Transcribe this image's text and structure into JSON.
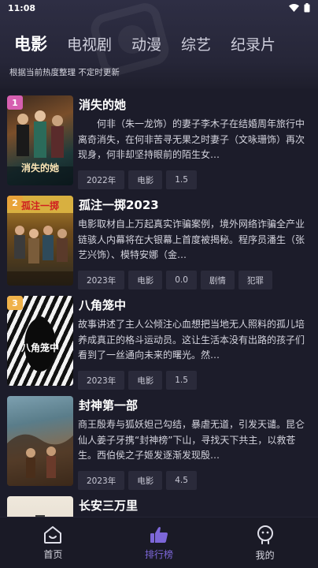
{
  "status": {
    "time": "11:08"
  },
  "tabs": [
    {
      "label": "电影"
    },
    {
      "label": "电视剧"
    },
    {
      "label": "动漫"
    },
    {
      "label": "综艺"
    },
    {
      "label": "纪录片"
    }
  ],
  "subtitle": "根据当前热度整理 不定时更新",
  "items": [
    {
      "rank": "1",
      "title": "消失的她",
      "poster_text": "消失的她",
      "description": "何非（朱一龙饰）的妻子李木子在结婚周年旅行中离奇消失，在何非苦寻无果之时妻子（文咏珊饰）再次现身，何非却坚持眼前的陌生女…",
      "tags": [
        "2022年",
        "电影",
        "1.5"
      ]
    },
    {
      "rank": "2",
      "title": "孤注一掷2023",
      "poster_text": "孤注一掷",
      "description": "电影取材自上万起真实诈骗案例，境外网络诈骗全产业链骇人内幕将在大银幕上首度被揭秘。程序员潘生（张艺兴饰）、模特安娜（金…",
      "tags": [
        "2023年",
        "电影",
        "0.0",
        "剧情",
        "犯罪"
      ]
    },
    {
      "rank": "3",
      "title": "八角笼中",
      "poster_text": "八角笼中",
      "description": "故事讲述了主人公倾注心血想把当地无人照料的孤儿培养成真正的格斗运动员。这让生活本没有出路的孩子们看到了一丝通向未来的曙光。然…",
      "tags": [
        "2023年",
        "电影",
        "1.5"
      ]
    },
    {
      "rank": "",
      "title": "封神第一部",
      "poster_text": "",
      "description": "商王殷寿与狐妖妲己勾结，暴虐无道，引发天谴。昆仑仙人姜子牙携“封神榜”下山，寻找天下共主，以救苍生。西伯侯之子姬发逐渐发现殷…",
      "tags": [
        "2023年",
        "电影",
        "4.5"
      ]
    },
    {
      "rank": "",
      "title": "长安三万里",
      "poster_text": "",
      "description": "",
      "tags": []
    }
  ],
  "nav": [
    {
      "label": "首页",
      "icon": "home-icon"
    },
    {
      "label": "排行榜",
      "icon": "thumbs-up-icon"
    },
    {
      "label": "我的",
      "icon": "profile-icon"
    }
  ],
  "colors": {
    "accent": "#7d67d9",
    "rank1": "#d65fb0",
    "rank2": "#e8a33a",
    "rank3": "#f0b24a"
  }
}
